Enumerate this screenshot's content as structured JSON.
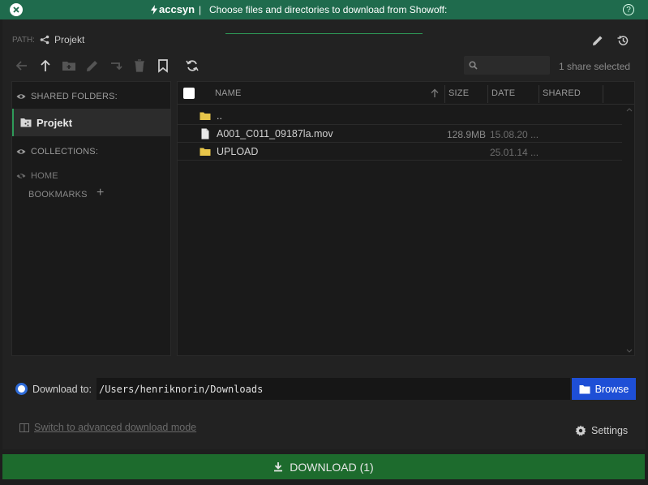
{
  "titlebar": {
    "brand": "accsyn",
    "separator": "|",
    "title": "Choose files and directories to download from Showoff:",
    "help": "?"
  },
  "path": {
    "label": "PATH:",
    "value": "Projekt"
  },
  "toolbar": {
    "search_placeholder": "",
    "share_selected": "1 share selected"
  },
  "sidebar": {
    "shared_folders_heading": "SHARED FOLDERS:",
    "active_share": "Projekt",
    "collections_heading": "COLLECTIONS:",
    "home": "HOME",
    "bookmarks": "BOOKMARKS",
    "add": "+"
  },
  "filelist": {
    "columns": {
      "name": "NAME",
      "size": "SIZE",
      "date": "DATE",
      "shared": "SHARED"
    },
    "rows": [
      {
        "name": "..",
        "type": "folder",
        "size": "",
        "date": ""
      },
      {
        "name": "A001_C011_09187la.mov",
        "type": "file",
        "size": "128.9MB",
        "date": "15.08.20 ..."
      },
      {
        "name": "UPLOAD",
        "type": "folder",
        "size": "",
        "date": "25.01.14 ..."
      }
    ]
  },
  "download": {
    "label": "Download to:",
    "path": "/Users/henriknorin/Downloads",
    "browse_label": "Browse"
  },
  "footer": {
    "advanced_mode": "Switch to advanced download mode",
    "settings": "Settings",
    "download_button": "DOWNLOAD (1)"
  },
  "colors": {
    "titlebar": "#1f6b4d",
    "accent_green": "#2e9a58",
    "browse_blue": "#1e4fd6",
    "download_bar": "#1d6b2d",
    "folder_yellow": "#e8c64a"
  }
}
